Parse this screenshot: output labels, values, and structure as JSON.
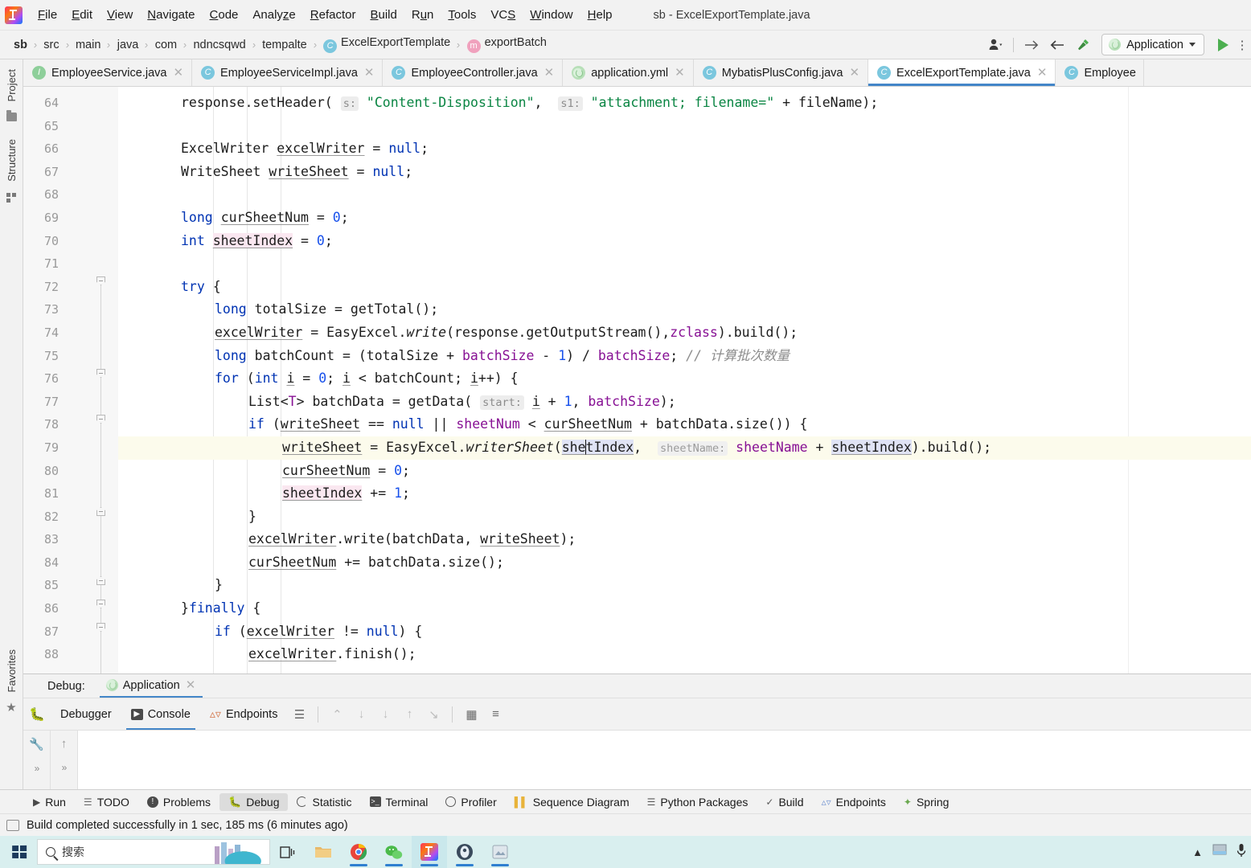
{
  "window": {
    "title": "sb - ExcelExportTemplate.java",
    "logo_icon": "intellij-idea-logo"
  },
  "menu": {
    "items": [
      {
        "label": "File"
      },
      {
        "label": "Edit"
      },
      {
        "label": "View"
      },
      {
        "label": "Navigate"
      },
      {
        "label": "Code"
      },
      {
        "label": "Analyze"
      },
      {
        "label": "Refactor"
      },
      {
        "label": "Build"
      },
      {
        "label": "Run"
      },
      {
        "label": "Tools"
      },
      {
        "label": "VCS"
      },
      {
        "label": "Window"
      },
      {
        "label": "Help"
      }
    ]
  },
  "navbar": {
    "crumbs": [
      {
        "label": "sb",
        "bold": true
      },
      {
        "label": "src"
      },
      {
        "label": "main"
      },
      {
        "label": "java"
      },
      {
        "label": "com"
      },
      {
        "label": "ndncsqwd"
      },
      {
        "label": "tempalte"
      },
      {
        "label": "ExcelExportTemplate",
        "badge": "C"
      },
      {
        "label": "exportBatch",
        "badge": "m"
      }
    ],
    "separator": "›",
    "run_config": "Application",
    "icons": {
      "user": "user-avatar-icon",
      "forward": "forward-arrow-icon",
      "back": "back-arrow-icon",
      "build": "hammer-icon",
      "run": "run-triangle-icon",
      "more": "more-vertical-icon"
    },
    "accent": "#4386c8"
  },
  "tool_strips": {
    "left_top": [
      {
        "label": "Project",
        "icon": "folder-icon"
      },
      {
        "label": "Structure",
        "icon": "structure-icon"
      }
    ],
    "left_bottom": [
      {
        "label": "Favorites",
        "icon": "star-icon"
      }
    ]
  },
  "editor_tabs": [
    {
      "label": "EmployeeService.java",
      "icon": "interface-icon",
      "icon_letter": "I",
      "kind": "i",
      "active": false
    },
    {
      "label": "EmployeeServiceImpl.java",
      "icon": "class-icon",
      "icon_letter": "C",
      "kind": "c",
      "active": false
    },
    {
      "label": "EmployeeController.java",
      "icon": "class-icon",
      "icon_letter": "C",
      "kind": "c",
      "active": false
    },
    {
      "label": "application.yml",
      "icon": "spring-yaml-icon",
      "icon_letter": "",
      "kind": "yml",
      "active": false
    },
    {
      "label": "MybatisPlusConfig.java",
      "icon": "class-icon",
      "icon_letter": "C",
      "kind": "c",
      "active": false
    },
    {
      "label": "ExcelExportTemplate.java",
      "icon": "class-icon",
      "icon_letter": "C",
      "kind": "c",
      "active": true
    },
    {
      "label": "Employee",
      "icon": "class-icon",
      "icon_letter": "C",
      "kind": "c",
      "active": false
    }
  ],
  "editor": {
    "first_line_number": 64,
    "highlighted_line": 79,
    "line_numbers": [
      64,
      65,
      66,
      67,
      68,
      69,
      70,
      71,
      72,
      73,
      74,
      75,
      76,
      77,
      78,
      79,
      80,
      81,
      82,
      83,
      84,
      85,
      86,
      87,
      88
    ],
    "lines": [
      "response.setHeader( s: \"Content-Disposition\",  s1: \"attachment; filename=\" + fileName);",
      "",
      "ExcelWriter excelWriter = null;",
      "WriteSheet writeSheet = null;",
      "",
      "long curSheetNum = 0;",
      "int sheetIndex = 0;",
      "",
      "try {",
      "long totalSize = getTotal();",
      "excelWriter = EasyExcel.write(response.getOutputStream(),zclass).build();",
      "long batchCount = (totalSize + batchSize - 1) / batchSize; // 计算批次数量",
      "for (int i = 0; i < batchCount; i++) {",
      "List<T> batchData = getData( start: i + 1, batchSize);",
      "if (writeSheet == null || sheetNum < curSheetNum + batchData.size()) {",
      "writeSheet = EasyExcel.writerSheet(sheetIndex,  sheetName: sheetName + sheetIndex).build();",
      "curSheetNum = 0;",
      "sheetIndex += 1;",
      "}",
      "excelWriter.write(batchData, writeSheet);",
      "curSheetNum += batchData.size();",
      "}",
      "}finally {",
      "if (excelWriter != null) {",
      "excelWriter.finish();"
    ],
    "partial_top_line": "responseSetHeader( s: \"...\")"
  },
  "debug_window": {
    "label": "Debug:",
    "session_tab": "Application",
    "session_icon": "spring-boot-icon",
    "close_icon": "close-icon",
    "bug_icon": "debug-bug-icon",
    "tabs": [
      {
        "label": "Debugger",
        "icon": "",
        "active": false
      },
      {
        "label": "Console",
        "icon": "console-icon",
        "active": true
      },
      {
        "label": "Endpoints",
        "icon": "endpoints-icon",
        "active": false
      }
    ],
    "toolbar_icons": [
      "layout-icon",
      "step-over-icon",
      "step-into-icon",
      "force-step-into-icon",
      "step-out-icon",
      "run-to-cursor-icon",
      "evaluate-table-icon",
      "settings-sliders-icon"
    ],
    "sidebar_icons": [
      "wrench-icon",
      "expand-chevrons-icon"
    ],
    "sidebar2_icons": [
      "up-arrow-icon",
      "expand-chevrons-icon"
    ],
    "console_text": ""
  },
  "bottom_tabs": [
    {
      "label": "Run",
      "icon": "run-triangle-icon",
      "active": false
    },
    {
      "label": "TODO",
      "icon": "todo-list-icon",
      "active": false
    },
    {
      "label": "Problems",
      "icon": "problems-icon",
      "active": false
    },
    {
      "label": "Debug",
      "icon": "debug-bug-icon",
      "active": true
    },
    {
      "label": "Statistic",
      "icon": "statistic-pie-icon",
      "active": false
    },
    {
      "label": "Terminal",
      "icon": "terminal-icon",
      "active": false
    },
    {
      "label": "Profiler",
      "icon": "profiler-icon",
      "active": false
    },
    {
      "label": "Sequence Diagram",
      "icon": "sequence-diagram-icon",
      "active": false
    },
    {
      "label": "Python Packages",
      "icon": "python-packages-icon",
      "active": false
    },
    {
      "label": "Build",
      "icon": "hammer-icon",
      "active": false
    },
    {
      "label": "Endpoints",
      "icon": "endpoints-icon",
      "active": false
    },
    {
      "label": "Spring",
      "icon": "spring-leaf-icon",
      "active": false
    }
  ],
  "status_bar": {
    "icon": "build-status-icon",
    "message": "Build completed successfully in 1 sec, 185 ms (6 minutes ago)"
  },
  "taskbar": {
    "start_icon": "windows-start-icon",
    "search_placeholder": "搜索",
    "search_icon": "search-icon",
    "items": [
      {
        "icon": "task-view-icon",
        "name": "task-view",
        "running": false,
        "active": false
      },
      {
        "icon": "file-explorer-icon",
        "name": "file-explorer",
        "running": false,
        "active": false
      },
      {
        "icon": "chrome-icon",
        "name": "google-chrome",
        "running": true,
        "active": false
      },
      {
        "icon": "wechat-icon",
        "name": "wechat",
        "running": true,
        "active": false
      },
      {
        "icon": "intellij-idea-icon",
        "name": "intellij-idea",
        "running": true,
        "active": true
      },
      {
        "icon": "app-icon",
        "name": "media-app",
        "running": true,
        "active": false
      },
      {
        "icon": "editor-icon",
        "name": "snipping-tool",
        "running": true,
        "active": false
      }
    ],
    "tray": [
      {
        "icon": "chevron-up-icon",
        "name": "show-hidden-icons"
      },
      {
        "icon": "display-icon",
        "name": "display-settings"
      },
      {
        "icon": "microphone-icon",
        "name": "microphone"
      }
    ]
  }
}
